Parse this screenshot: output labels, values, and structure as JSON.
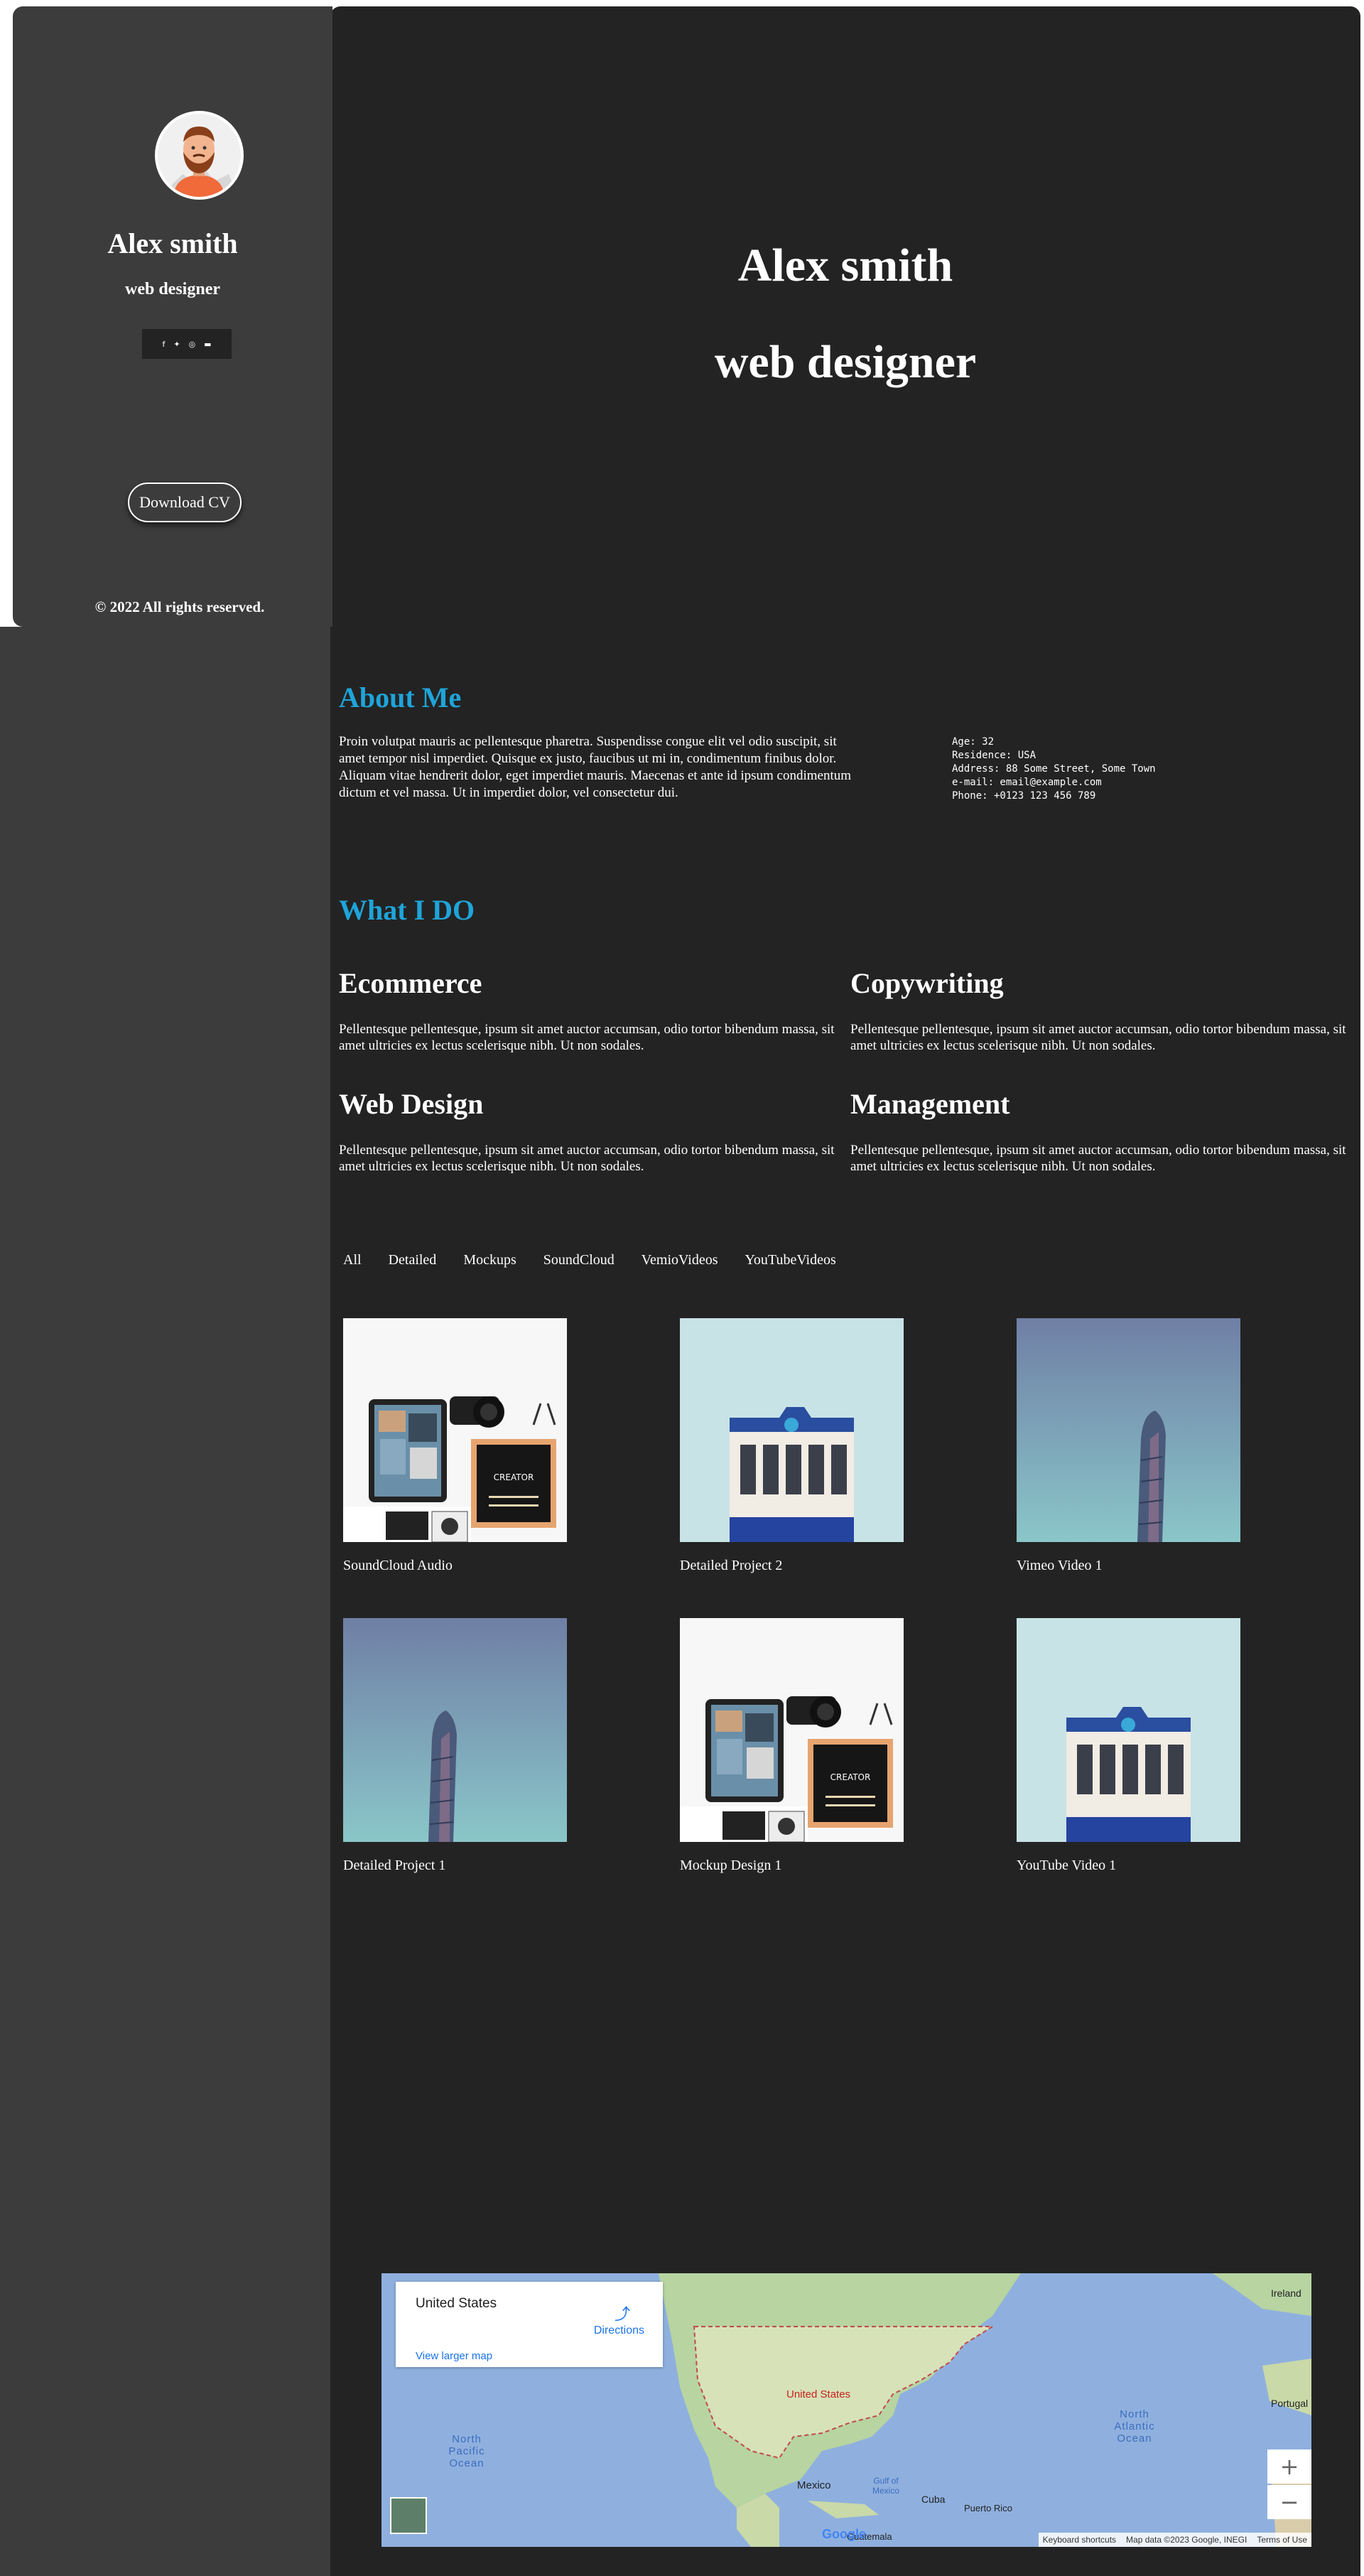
{
  "sidebar": {
    "name": "Alex smith",
    "title": "web designer",
    "social": [
      "f",
      "t",
      "ig",
      "yt"
    ],
    "download_label": "Download CV",
    "copyright": "© 2022 All rights reserved."
  },
  "hero": {
    "name": "Alex smith",
    "title": "web designer"
  },
  "about": {
    "heading": "About Me",
    "text": "Proin volutpat mauris ac pellentesque pharetra. Suspendisse congue elit vel odio suscipit, sit amet tempor nisl imperdiet. Quisque ex justo, faucibus ut mi in, condimentum finibus dolor. Aliquam vitae hendrerit dolor, eget imperdiet mauris. Maecenas et ante id ipsum condimentum dictum et vel massa. Ut in imperdiet dolor, vel consectetur dui.",
    "info": [
      "Age: 32",
      "Residence: USA",
      "Address: 88 Some Street, Some Town",
      "e-mail: email@example.com",
      "Phone: +0123 123 456 789"
    ]
  },
  "services": {
    "heading": "What I DO",
    "items": [
      {
        "title": "Ecommerce",
        "text": "Pellentesque pellentesque, ipsum sit amet auctor accumsan, odio tortor bibendum massa, sit amet ultricies ex lectus scelerisque nibh. Ut non sodales."
      },
      {
        "title": "Copywriting",
        "text": "Pellentesque pellentesque, ipsum sit amet auctor accumsan, odio tortor bibendum massa, sit amet ultricies ex lectus scelerisque nibh. Ut non sodales."
      },
      {
        "title": "Web Design",
        "text": "Pellentesque pellentesque, ipsum sit amet auctor accumsan, odio tortor bibendum massa, sit amet ultricies ex lectus scelerisque nibh. Ut non sodales."
      },
      {
        "title": "Management",
        "text": "Pellentesque pellentesque, ipsum sit amet auctor accumsan, odio tortor bibendum massa, sit amet ultricies ex lectus scelerisque nibh. Ut non sodales."
      }
    ]
  },
  "portfolio": {
    "filters": [
      "All",
      "Detailed",
      "Mockups",
      "SoundCloud",
      "VemioVideos",
      "YouTubeVideos"
    ],
    "items": [
      {
        "caption": "SoundCloud Audio",
        "image": "desk-flatlay"
      },
      {
        "caption": "Detailed Project 2",
        "image": "blue-building"
      },
      {
        "caption": "Vimeo Video 1",
        "image": "tower"
      },
      {
        "caption": "Detailed Project 1",
        "image": "tower"
      },
      {
        "caption": "Mockup Design 1",
        "image": "desk-flatlay"
      },
      {
        "caption": "YouTube Video 1",
        "image": "blue-building"
      }
    ]
  },
  "map": {
    "place": "United States",
    "directions": "Directions",
    "larger": "View larger map",
    "labels": {
      "us": "United States",
      "mexico": "Mexico",
      "cuba": "Cuba",
      "pacific": "North Pacific Ocean",
      "atlantic": "North Atlantic Ocean",
      "ireland": "Ireland",
      "portugal": "Portugal",
      "guatemala": "Guatemala",
      "gulf": "Gulf of Mexico",
      "puerto_rico": "Puerto Rico",
      "google": "Google"
    },
    "footer": [
      "Keyboard shortcuts",
      "Map data ©2023 Google, INEGI",
      "Terms of Use"
    ]
  },
  "colors": {
    "sidebar": "#3c3c3c",
    "main": "#232323",
    "accent": "#1fa4d9"
  }
}
